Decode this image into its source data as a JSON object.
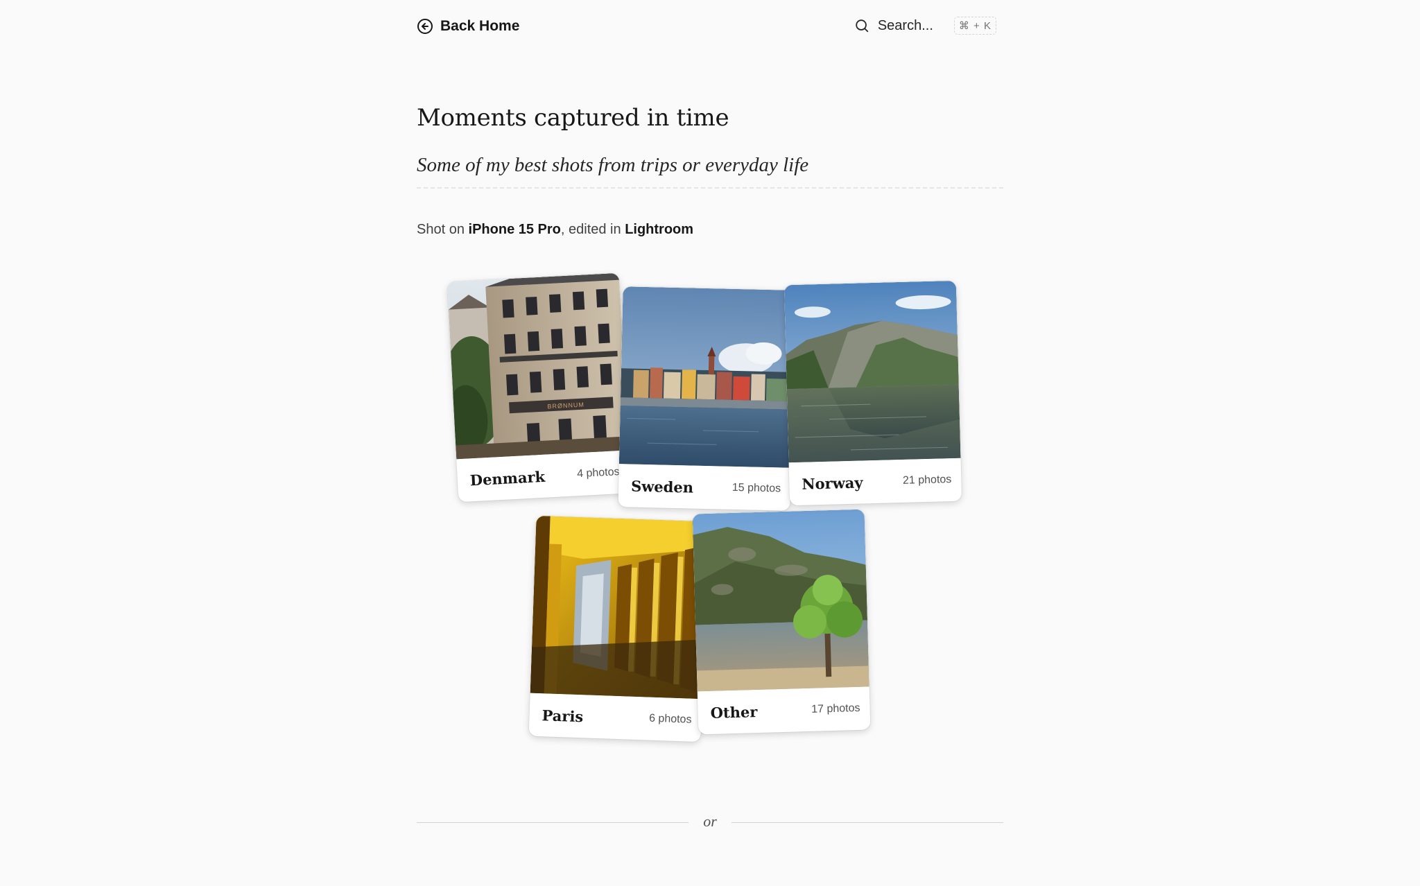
{
  "header": {
    "back_label": "Back Home",
    "back_icon": "arrow-left-circle-icon",
    "search_label": "Search...",
    "search_icon": "search-icon",
    "search_shortcut": "⌘ + K"
  },
  "main": {
    "title": "Moments captured in time",
    "subtitle": "Some of my best shots from trips or everyday life",
    "shot_on": {
      "prefix": "Shot on ",
      "device": "iPhone 15 Pro",
      "middle": ", edited in ",
      "software": "Lightroom"
    },
    "albums": [
      {
        "name": "Denmark",
        "count": "4 photos"
      },
      {
        "name": "Sweden",
        "count": "15 photos"
      },
      {
        "name": "Norway",
        "count": "21 photos"
      },
      {
        "name": "Paris",
        "count": "6 photos"
      },
      {
        "name": "Other",
        "count": "17 photos"
      }
    ],
    "divider_text": "or"
  },
  "colors": {
    "background": "#fafafa",
    "text": "#171717",
    "muted": "#525252",
    "card": "#ffffff"
  }
}
